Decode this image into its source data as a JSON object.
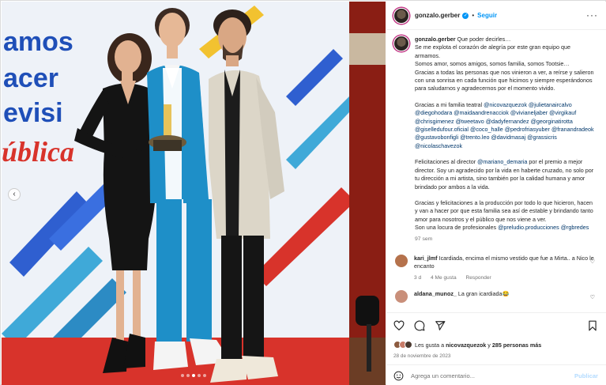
{
  "post": {
    "username": "gonzalo.gerber",
    "verified_symbol": "✓",
    "separator": "•",
    "follow_label": "Seguir",
    "more_label": "···"
  },
  "photo": {
    "backdrop_words": [
      "amos",
      "acer",
      "evisi",
      "ública"
    ],
    "prev_label": "‹",
    "dots_count": 5,
    "active_dot": 2
  },
  "caption": {
    "lines": [
      "Que poder decirles…",
      "Se me explota el corazón de alegría por este gran equipo que armamos.",
      "Somos amor, somos amigos, somos familia, somos Tootsie…",
      "Gracias a todas las personas que nos vinieron a ver, a reírse y salieron con una sonrisa en cada función que hicimos y siempre esperándonos para saludarnos y agradecernos por el momento vivido."
    ],
    "family_intro": "Gracias a mi familia teatral",
    "family_tags": [
      "@nicovazquezok",
      "@julietanaircalvo",
      "@diegohodara",
      "@maidaandrenacciok",
      "@vivianeljaber",
      "@virgikauf",
      "@chrisgimenez",
      "@tweetavo",
      "@dadyfernandez",
      "@georginatirotta",
      "@giselledufour.oficial",
      "@coco_halle",
      "@pedrofriasyuber",
      "@franandradeok",
      "@gustavobonfigli",
      "@trento.leo",
      "@davidmasaj",
      "@grassicris",
      "@nicolaschavezok"
    ],
    "director_pre": "Felicitaciones al director",
    "director_tag": "@mariano_demaria",
    "director_post": "por el premio a mejor director. Soy un agradecido por la vida en haberte cruzado, no solo por tu dirección a mi artista, sino también por la calidad humana y amor brindado por ambos a la vida.",
    "production_text": "Gracias y felicitaciones a la producción por todo lo que hicieron, hacen y van a hacer por que esta familia sea así de estable y brindando tanto amor para nosotros y el público que nos viene a ver.",
    "pros_pre": "Son una locura de profesionales",
    "pros_tags": [
      "@preludio.producciones",
      "@rgbredes"
    ],
    "time": "97 sem"
  },
  "comments": [
    {
      "username": "kari_jlmf",
      "text": "Icardiada, encima el mismo vestido que fue a Mirta.. a Nico le encanto",
      "time": "3 d",
      "likes": "4 Me gusta",
      "reply": "Responder"
    },
    {
      "username": "aldana_munoz_",
      "text": "La gran icardiada😂"
    }
  ],
  "footer": {
    "likes_pre": "Les gusta a",
    "likes_user": "nicovazquezok",
    "likes_mid": "y",
    "likes_count": "285 personas más",
    "date": "28 de noviembre de 2023",
    "comment_placeholder": "Agrega un comentario...",
    "publish_label": "Publicar"
  },
  "colors": {
    "accent_blue": "#0095f6",
    "link_blue": "#00376b",
    "carpet_red": "#d8332b",
    "suit_blue": "#1e8fc8"
  }
}
